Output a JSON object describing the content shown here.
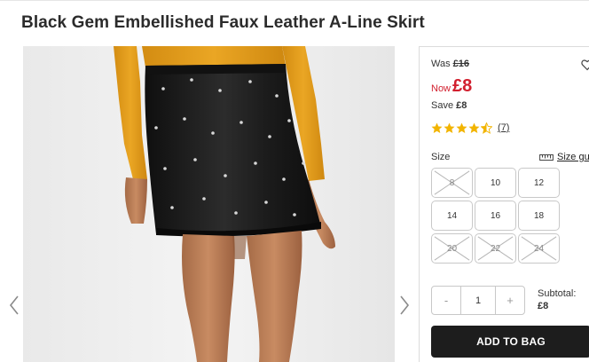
{
  "product": {
    "title": "Black Gem Embellished Faux Leather A-Line Skirt"
  },
  "price": {
    "was_label": "Was",
    "was_amount": "£16",
    "now_label": "Now",
    "now_amount": "£8",
    "save_label": "Save",
    "save_amount": "£8"
  },
  "rating": {
    "stars_value": 4.5,
    "stars_max": 5,
    "review_count": "(7)",
    "color": "#f2b400"
  },
  "sizes": {
    "label": "Size",
    "guide_label": "Size gu",
    "options": [
      {
        "label": "8",
        "available": false
      },
      {
        "label": "10",
        "available": true
      },
      {
        "label": "12",
        "available": true
      },
      {
        "label": "14",
        "available": true
      },
      {
        "label": "16",
        "available": true
      },
      {
        "label": "18",
        "available": true
      },
      {
        "label": "20",
        "available": false
      },
      {
        "label": "22",
        "available": false
      },
      {
        "label": "24",
        "available": false
      }
    ]
  },
  "quantity": {
    "minus": "-",
    "value": "1",
    "plus": "+"
  },
  "subtotal": {
    "label": "Subtotal:",
    "amount": "£8"
  },
  "cart": {
    "add_label": "ADD TO BAG"
  },
  "icons": {
    "gallery_prev": "chevron-left-icon",
    "gallery_next": "chevron-right-icon",
    "wishlist": "heart-icon",
    "size_guide": "ruler-icon",
    "star": "star-icon"
  },
  "colors": {
    "sale_red": "#d2202f",
    "button_dark": "#1d1d1d",
    "sweater_mustard": "#e8a21c",
    "skirt_black": "#1a1a1a"
  }
}
